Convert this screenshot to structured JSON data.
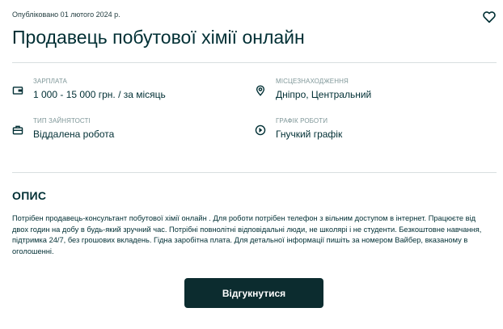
{
  "published": "Опубліковано 01 лютого 2024 р.",
  "title": "Продавець побутової хімії онлайн",
  "favorite_icon": "heart-icon",
  "attributes": [
    {
      "label": "ЗАРПЛАТА",
      "value": "1 000 - 15 000 грн. / за місяць",
      "icon": "wallet-icon"
    },
    {
      "label": "МІСЦЕЗНАХОДЖЕННЯ",
      "value": "Дніпро, Центральний",
      "icon": "location-pin-icon"
    },
    {
      "label": "ТИП ЗАЙНЯТОСТІ",
      "value": "Віддалена робота",
      "icon": "briefcase-icon"
    },
    {
      "label": "ГРАФІК РОБОТИ",
      "value": "Гнучкий графік",
      "icon": "play-circle-icon"
    }
  ],
  "description": {
    "title": "ОПИС",
    "text": "Потрібен продавець-консультант побутової хімії онлайн . Для роботи потрібен телефон з вільним доступом в інтернет. Працюєте від двох годин на добу в будь-який зручний час. Потрібні повнолітні відповідальні люди, не школярі і не студенти. Безкоштовне навчання, підтримка 24/7, без грошових вкладень. Гідна заробітна плата. Для детальної інформації пишіть за номером Вайбер, вказаному в оголошенні."
  },
  "apply_button": "Відгукнутися",
  "colors": {
    "text": "#002f34",
    "muted": "#7f9799",
    "button": "#0c2c2f",
    "divider": "#d8dfe0"
  }
}
